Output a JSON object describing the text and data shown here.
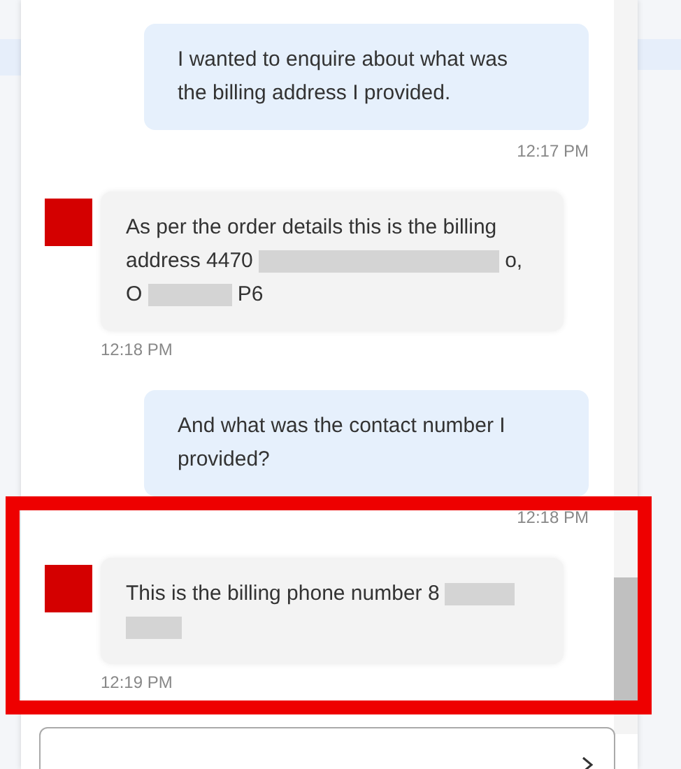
{
  "messages": [
    {
      "kind": "user",
      "parts": [
        {
          "kind": "text",
          "text": "I wanted to enquire about what was the billing address I provided."
        }
      ],
      "time": "12:17 PM",
      "highlighted": false
    },
    {
      "kind": "agent",
      "parts": [
        {
          "kind": "text",
          "text": "As per the order details this is the billing address 4470"
        },
        {
          "kind": "redacted"
        },
        {
          "kind": "text",
          "text": "o,"
        },
        {
          "kind": "text",
          "text": "O"
        },
        {
          "kind": "redacted"
        },
        {
          "kind": "text",
          "text": "P6"
        }
      ],
      "time": "12:18 PM",
      "highlighted": false
    },
    {
      "kind": "user",
      "parts": [
        {
          "kind": "text",
          "text": "And what was the contact number I provided?"
        }
      ],
      "time": "12:18 PM",
      "highlighted": false
    },
    {
      "kind": "agent",
      "parts": [
        {
          "kind": "text",
          "text": "This is the billing phone number 8"
        },
        {
          "kind": "redacted"
        },
        {
          "kind": "redacted"
        }
      ],
      "time": "12:19 PM",
      "highlighted": true
    }
  ]
}
